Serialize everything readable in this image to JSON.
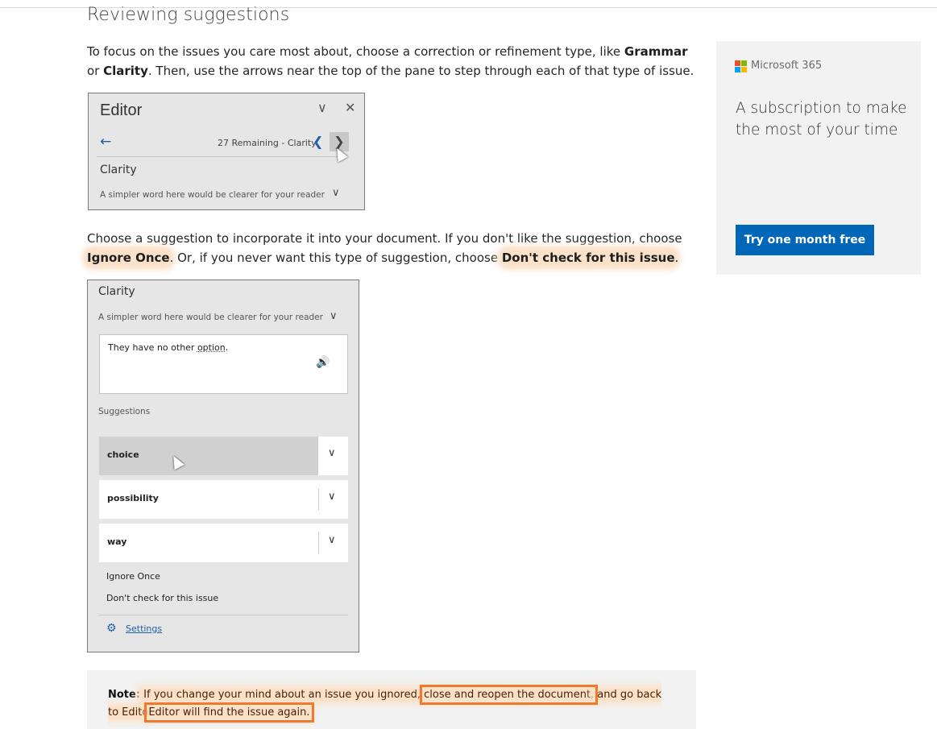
{
  "page": {
    "heading": "Reviewing suggestions",
    "intro": {
      "part1": "To focus on the issues you care most about, choose a correction or refinement type, like ",
      "grammar": "Grammar",
      "part2": " or ",
      "clarity": "Clarity",
      "part3": ". Then, use the arrows near the top of the pane to step through each of that type of issue."
    },
    "choose": {
      "part1": "Choose a suggestion to incorporate it into your document. If you don't like the suggestion, choose ",
      "ignore_once": "Ignore Once",
      "part2": ". Or, if you never want this type of suggestion, choose ",
      "dont_check": "Don't check for this issue",
      "part3": "."
    }
  },
  "editor_pane": {
    "title": "Editor",
    "chevron_icon": "chevron-down-icon",
    "close_icon": "close-icon",
    "back_icon": "back-arrow-icon",
    "remaining": "27 Remaining - Clarity",
    "prev_icon": "chevron-left-icon",
    "next_icon": "chevron-right-icon",
    "category": "Clarity",
    "description": "A simpler word here would be clearer for your reader"
  },
  "suggestion_pane": {
    "category": "Clarity",
    "description": "A simpler word here would be clearer for your reader",
    "sentence_prefix": "They have no other ",
    "sentence_word": "option",
    "sentence_suffix": ".",
    "speaker_icon": "speaker-icon",
    "suggestions_label": "Suggestions",
    "suggestions": [
      "choice",
      "possibility",
      "way"
    ],
    "ignore_once": "Ignore Once",
    "dont_check": "Don't check for this issue",
    "settings": "Settings",
    "settings_icon": "gear-icon"
  },
  "sidebar": {
    "brand": "Microsoft 365",
    "tagline": "A subscription to make the most of your time",
    "cta": "Try one month free",
    "cta_color": "#0067b8"
  },
  "note": {
    "label": "Note:",
    "part1": " If you change your mind about an issue you ignored, ",
    "boxed1": "close and reopen the document,",
    "part2": " and go back to Edito",
    "boxed2": "Editor will find the issue again."
  }
}
